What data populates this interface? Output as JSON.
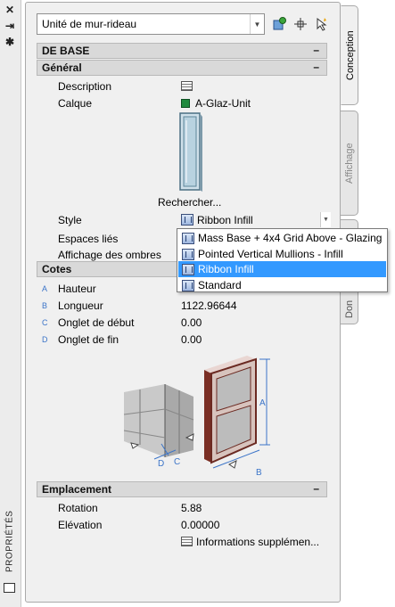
{
  "left_strip": {
    "icons": [
      "close-icon",
      "pin-icon",
      "gear-icon"
    ],
    "title": "PROPRIÉTÉS"
  },
  "header": {
    "object_type": "Unité de mur-rideau",
    "toolbar_icons": [
      "add-object-icon",
      "select-objects-icon",
      "quick-select-icon"
    ]
  },
  "sections": {
    "base": "DE BASE",
    "general": "Général",
    "dimensions": "Cotes",
    "location": "Emplacement"
  },
  "general": {
    "description_label": "Description",
    "layer_label": "Calque",
    "layer_value": "A-Glaz-Unit",
    "layer_color": "#1f8a3e",
    "browse_label": "Rechercher...",
    "style_label": "Style",
    "style_value": "Ribbon Infill",
    "spaces_label": "Espaces liés",
    "shadow_label": "Affichage des ombres"
  },
  "dimensions": {
    "height_letter": "A",
    "height_label": "Hauteur",
    "length_letter": "B",
    "length_label": "Longueur",
    "length_value": "1122.96644",
    "start_miter_letter": "C",
    "start_miter_label": "Onglet de début",
    "start_miter_value": "0.00",
    "end_miter_letter": "D",
    "end_miter_label": "Onglet de fin",
    "end_miter_value": "0.00",
    "diagram_labels": {
      "a": "A",
      "b": "B",
      "c": "C",
      "d": "D"
    }
  },
  "location": {
    "rotation_label": "Rotation",
    "rotation_value": "5.88",
    "elevation_label": "Elévation",
    "elevation_value": "0.00000",
    "more_info": "Informations  supplémen..."
  },
  "tabs": [
    "Conception",
    "Affichage",
    "Don"
  ],
  "dropdown": {
    "options": [
      "Mass Base + 4x4 Grid Above - Glazing",
      "Pointed Vertical Mullions - Infill",
      "Ribbon Infill",
      "Standard"
    ],
    "selected": "Ribbon Infill",
    "highlight_color": "#3399ff"
  }
}
